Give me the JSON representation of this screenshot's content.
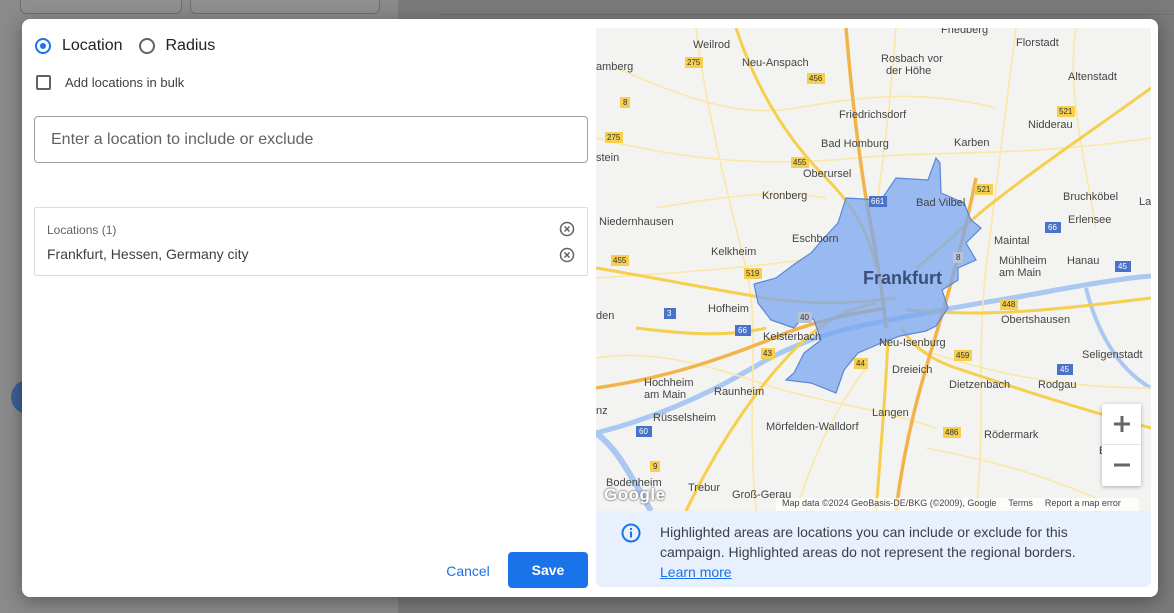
{
  "location_type": {
    "options": [
      {
        "label": "Location",
        "selected": true
      },
      {
        "label": "Radius",
        "selected": false
      }
    ]
  },
  "bulk": {
    "label": "Add locations in bulk",
    "checked": false
  },
  "search": {
    "placeholder": "Enter a location to include or exclude",
    "value": ""
  },
  "locations": {
    "header": "Locations (1)",
    "items": [
      "Frankfurt, Hessen, Germany city"
    ]
  },
  "footer": {
    "cancel_label": "Cancel",
    "save_label": "Save"
  },
  "map": {
    "place_labels": [
      "Weilrod",
      "Neu-Anspach",
      "Rosbach vor der Höhe",
      "Friedberg",
      "Florstadt",
      "amberg",
      "Altenstadt",
      "Friedrichsdorf",
      "Nidderau",
      "stein",
      "Bad Homburg",
      "Karben",
      "Oberursel",
      "Niedernhausen",
      "Kronberg",
      "Bad Vilbel",
      "Bruchköbel",
      "Lang",
      "Erlensee",
      "Eschborn",
      "Maintal",
      "Hanau",
      "Kelkheim",
      "Mühlheim am Main",
      "Frankfurt",
      "Hofheim",
      "Obertshausen",
      "den",
      "Kelsterbach",
      "Neu-Isenburg",
      "Seligenstadt",
      "Hochheim am Main",
      "Raunheim",
      "Dreieich",
      "Dietzenbach",
      "Rodgau",
      "nz",
      "Rüsselsheim",
      "Mörfelden-Walldorf",
      "Langen",
      "Rödermark",
      "Baben",
      "Bodenheim",
      "Trebur",
      "Groß-Gerau"
    ],
    "road_shields": [
      "275",
      "456",
      "8",
      "521",
      "275",
      "455",
      "661",
      "521",
      "66",
      "45",
      "455",
      "519",
      "8",
      "3",
      "66",
      "40",
      "448",
      "43",
      "44",
      "459",
      "45",
      "60",
      "486",
      "9",
      "45"
    ],
    "attribution": [
      "Map data ©2024 GeoBasis-DE/BKG (©2009), Google",
      "Terms",
      "Report a map error"
    ],
    "logo": "Google",
    "highlight_color": "#7ba7f0"
  },
  "info": {
    "text": "Highlighted areas are locations you can include or exclude for this campaign. Highlighted areas do not represent the regional borders.",
    "link": "Learn more"
  },
  "colors": {
    "accent": "#1a73e8",
    "info_bg": "#e8f0fe"
  }
}
